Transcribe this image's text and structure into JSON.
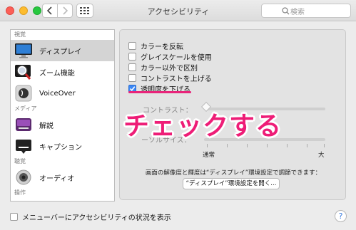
{
  "window": {
    "title": "アクセシビリティ"
  },
  "search": {
    "placeholder": "検索"
  },
  "sidebar": {
    "sections": [
      {
        "header": "視覚",
        "items": [
          {
            "label": "ディスプレイ",
            "icon": "display-icon",
            "selected": true
          },
          {
            "label": "ズーム機能",
            "icon": "zoom-icon",
            "selected": false
          },
          {
            "label": "VoiceOver",
            "icon": "voiceover-icon",
            "selected": false
          }
        ]
      },
      {
        "header": "メディア",
        "items": [
          {
            "label": "解説",
            "icon": "descriptions-icon",
            "selected": false
          },
          {
            "label": "キャプション",
            "icon": "captions-icon",
            "selected": false
          }
        ]
      },
      {
        "header": "聴覚",
        "items": [
          {
            "label": "オーディオ",
            "icon": "audio-icon",
            "selected": false
          }
        ]
      },
      {
        "header": "操作",
        "items": []
      }
    ]
  },
  "display": {
    "options": [
      {
        "label": "カラーを反転",
        "checked": false
      },
      {
        "label": "グレイスケールを使用",
        "checked": false
      },
      {
        "label": "カラー以外で区別",
        "checked": false
      },
      {
        "label": "コントラストを上げる",
        "checked": false
      },
      {
        "label": "透明度を下げる",
        "checked": true
      }
    ],
    "contrast_label": "コントラスト：",
    "cursor_label": "ーソルサイズ：",
    "slider_min": "通常",
    "slider_max": "大",
    "note": "画面の解像度と輝度は“ディスプレイ”環境設定で調節できます：",
    "open_button": "“ディスプレイ”環境設定を開く..."
  },
  "overlay": {
    "text": "チェックする",
    "color": "#ee1d77"
  },
  "footer": {
    "menubar_option": "メニューバーにアクセシビリティの状況を表示",
    "help": "?"
  }
}
